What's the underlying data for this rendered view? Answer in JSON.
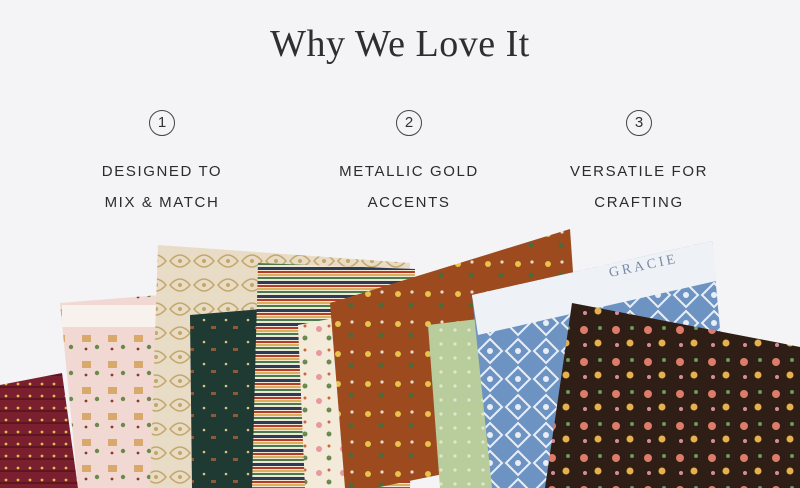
{
  "header": {
    "title": "Why We Love It"
  },
  "features": [
    {
      "number": "1",
      "line1": "DESIGNED TO",
      "line2": "MIX & MATCH"
    },
    {
      "number": "2",
      "line1": "METALLIC GOLD",
      "line2": "ACCENTS"
    },
    {
      "number": "3",
      "line1": "VERSATILE FOR",
      "line2": "CRAFTING"
    }
  ],
  "fabric_selvage_text": "GRACIE",
  "colors": {
    "background": "#f4f3f5",
    "burgundy": "#7a1f2e",
    "blush": "#f1d8d2",
    "cream": "#e8dcc6",
    "forest": "#1f3a33",
    "rust": "#9c4a1e",
    "sage": "#b9cc9c",
    "blue": "#6d93c3",
    "chocolate": "#2e1e16"
  }
}
